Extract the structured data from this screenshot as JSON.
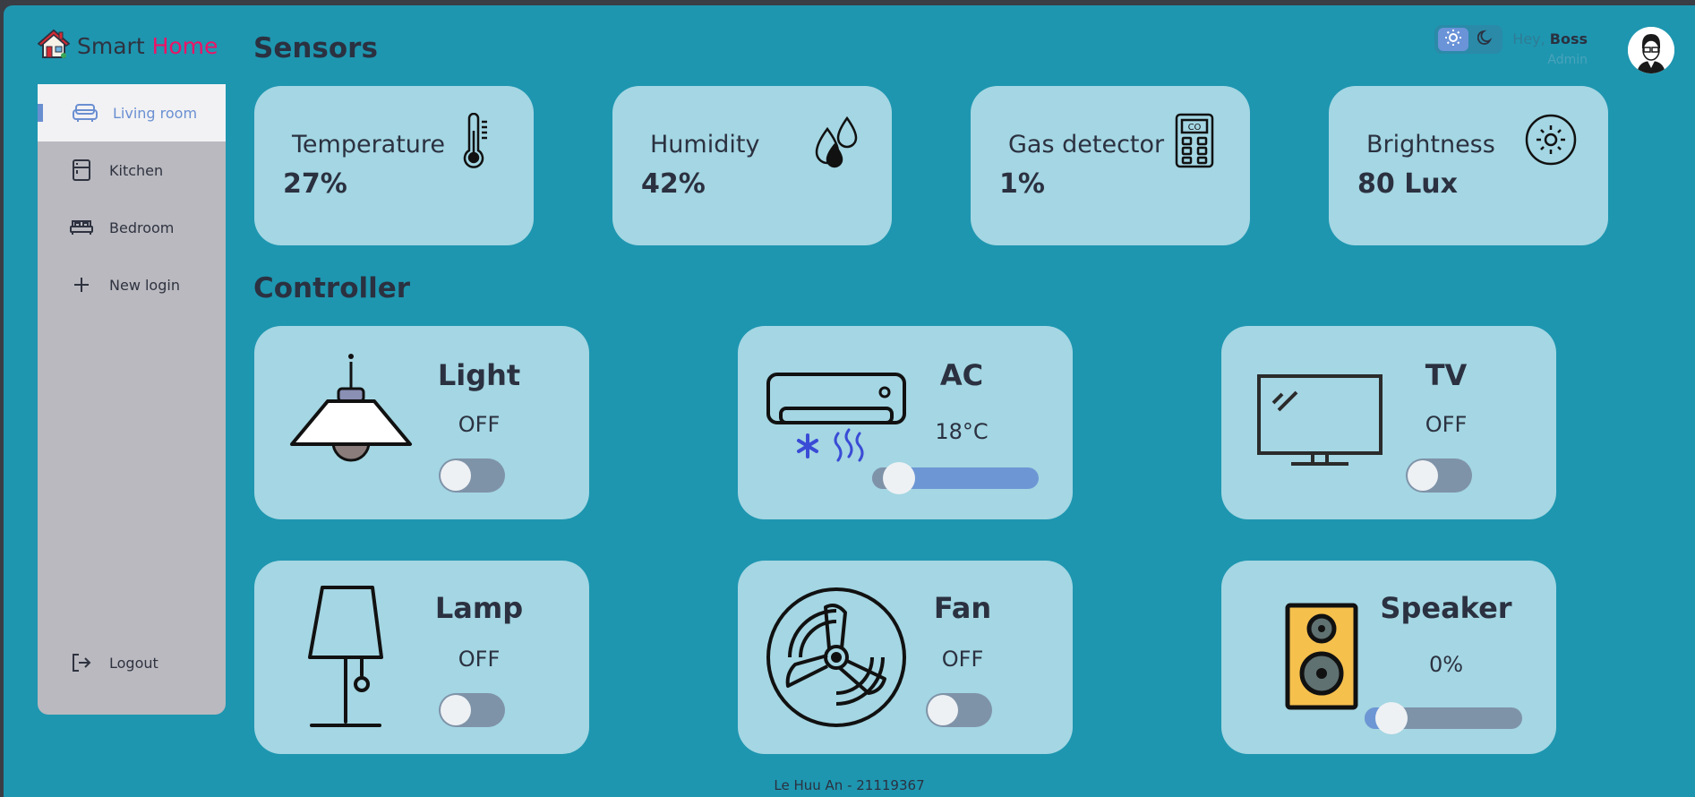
{
  "brand": {
    "part1": "Smart",
    "part2": "Home"
  },
  "sidebar": {
    "items": [
      {
        "label": "Living room",
        "icon": "sofa-icon"
      },
      {
        "label": "Kitchen",
        "icon": "fridge-icon"
      },
      {
        "label": "Bedroom",
        "icon": "bed-icon"
      },
      {
        "label": "New login",
        "icon": "plus-icon"
      }
    ],
    "logout": "Logout"
  },
  "headings": {
    "sensors": "Sensors",
    "controller": "Controller"
  },
  "user": {
    "greeting": "Hey,",
    "name": "Boss",
    "role": "Admin"
  },
  "sensors": [
    {
      "name": "Temperature",
      "value": "27%",
      "icon": "thermometer-icon"
    },
    {
      "name": "Humidity",
      "value": "42%",
      "icon": "water-drops-icon"
    },
    {
      "name": "Gas detector",
      "value": "1%",
      "icon": "co-detector-icon"
    },
    {
      "name": "Brightness",
      "value": "80 Lux",
      "icon": "sun-icon"
    }
  ],
  "controllers": [
    {
      "name": "Light",
      "state": "OFF",
      "control": "toggle",
      "on": false
    },
    {
      "name": "AC",
      "state": "18°C",
      "control": "slider",
      "level": 0.0
    },
    {
      "name": "TV",
      "state": "OFF",
      "control": "toggle",
      "on": false
    },
    {
      "name": "Lamp",
      "state": "OFF",
      "control": "toggle",
      "on": false
    },
    {
      "name": "Fan",
      "state": "OFF",
      "control": "toggle",
      "on": false
    },
    {
      "name": "Speaker",
      "state": "0%",
      "control": "slider",
      "level": 0.0
    }
  ],
  "footer": "Le Huu An - 21119367",
  "colors": {
    "background": "#1e96b0",
    "card": "#a4d6e3",
    "brand_accent": "#ee1366",
    "active_nav": "#6a8fd1",
    "sidebar": "#b9b9bf"
  }
}
